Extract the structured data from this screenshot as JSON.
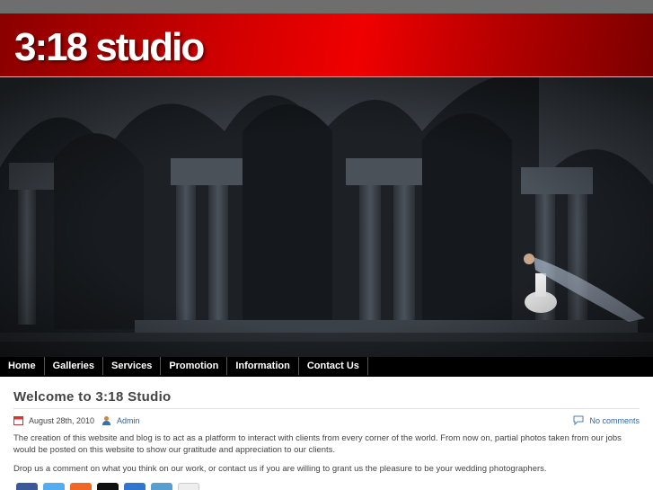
{
  "site": {
    "logo": "3:18 studio"
  },
  "nav": {
    "items": [
      {
        "label": "Home"
      },
      {
        "label": "Galleries"
      },
      {
        "label": "Services"
      },
      {
        "label": "Promotion"
      },
      {
        "label": "Information"
      },
      {
        "label": "Contact Us"
      }
    ]
  },
  "post": {
    "title": "Welcome to 3:18 Studio",
    "date": "August 28th, 2010",
    "author": "Admin",
    "comments": "No comments",
    "paragraphs": [
      "The creation of this website and blog is to act as a platform to interact with clients from every corner of the world. From now on, partial photos taken from our jobs would be posted on this website to show our gratitude and  appreciation to our clients.",
      "Drop us a comment on what you think on our work, or contact us if you are willing to grant us the pleasure to be your wedding photographers."
    ]
  },
  "share_icons": [
    "facebook-icon",
    "twitter-icon",
    "rss-icon",
    "digg-icon",
    "delicious-icon",
    "stumbleupon-icon",
    "email-icon"
  ],
  "colors": {
    "header_red": "#d10000",
    "nav_bg": "#000000",
    "link": "#336699"
  }
}
